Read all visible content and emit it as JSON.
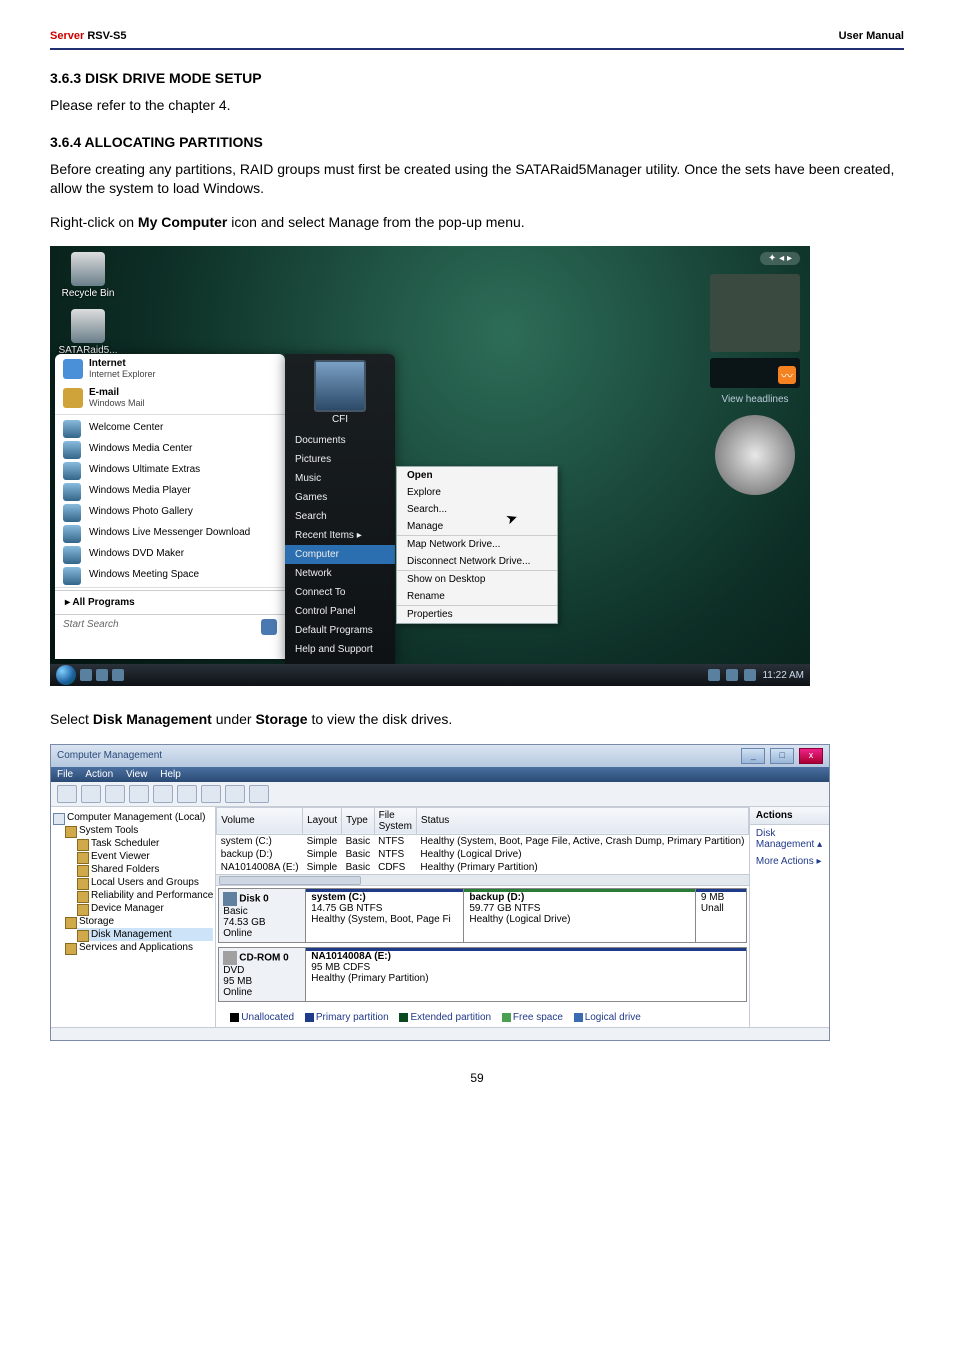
{
  "header": {
    "server_label": "Server",
    "model": " RSV-S5",
    "right": "User Manual"
  },
  "section1": {
    "title": "3.6.3 DISK DRIVE MODE SETUP",
    "text": "Please refer to the chapter 4."
  },
  "section2": {
    "title": "3.6.4 ALLOCATING PARTITIONS",
    "text": "Before creating any partitions, RAID groups must first be created using the SATARaid5Manager utility. Once the sets have been created, allow the system to load Windows.",
    "step1a": "Right-click on ",
    "step1b": "My Computer",
    "step1c": " icon and select Manage from the pop-up menu.",
    "step2a": "Select ",
    "step2b": "Disk Management",
    "step2c": " under ",
    "step2d": "Storage",
    "step2e": " to view the disk drives."
  },
  "shot1": {
    "titlebar_arrows": "✦  ◂ ▸",
    "desk": {
      "recycle": "Recycle Bin",
      "sataraid": "SATARaid5..."
    },
    "sidebar": {
      "headlines": "View headlines"
    },
    "start_left": {
      "internet_t": "Internet",
      "internet_s": "Internet Explorer",
      "email_t": "E-mail",
      "email_s": "Windows Mail",
      "items": [
        "Welcome Center",
        "Windows Media Center",
        "Windows Ultimate Extras",
        "Windows Media Player",
        "Windows Photo Gallery",
        "Windows Live Messenger Download",
        "Windows DVD Maker",
        "Windows Meeting Space"
      ],
      "all": "▸    All Programs",
      "search": "Start Search"
    },
    "start_right": {
      "name": "CFI",
      "items": [
        "Documents",
        "Pictures",
        "Music",
        "Games",
        "Search",
        "Recent Items        ▸",
        "Computer",
        "Network",
        "Connect To",
        "Control Panel",
        "Default Programs",
        "Help and Support"
      ],
      "selected_index": 6
    },
    "ctx": [
      "Open",
      "Explore",
      "Search...",
      "Manage",
      "Map Network Drive...",
      "Disconnect Network Drive...",
      "Show on Desktop",
      "Rename",
      "Properties"
    ],
    "taskbar": {
      "time": "11:22 AM"
    }
  },
  "shot2": {
    "title": "Computer Management",
    "menu": [
      "File",
      "Action",
      "View",
      "Help"
    ],
    "tree": {
      "root": "Computer Management (Local)",
      "system_tools": "System Tools",
      "st_items": [
        "Task Scheduler",
        "Event Viewer",
        "Shared Folders",
        "Local Users and Groups",
        "Reliability and Performance",
        "Device Manager"
      ],
      "storage": "Storage",
      "storage_items": [
        "Disk Management"
      ],
      "services": "Services and Applications"
    },
    "grid": {
      "headers": [
        "Volume",
        "Layout",
        "Type",
        "File System",
        "Status"
      ],
      "rows": [
        {
          "v": "system (C:)",
          "l": "Simple",
          "t": "Basic",
          "f": "NTFS",
          "s": "Healthy (System, Boot, Page File, Active, Crash Dump, Primary Partition)"
        },
        {
          "v": "backup (D:)",
          "l": "Simple",
          "t": "Basic",
          "f": "NTFS",
          "s": "Healthy (Logical Drive)"
        },
        {
          "v": "NA1014008A (E:)",
          "l": "Simple",
          "t": "Basic",
          "f": "CDFS",
          "s": "Healthy (Primary Partition)"
        }
      ]
    },
    "disk0": {
      "head_t": "Disk 0",
      "head_type": "Basic",
      "head_size": "74.53 GB",
      "head_status": "Online",
      "p1_t": "system (C:)",
      "p1_s": "14.75 GB NTFS",
      "p1_st": "Healthy (System, Boot, Page Fi",
      "p2_t": "backup (D:)",
      "p2_s": "59.77 GB NTFS",
      "p2_st": "Healthy (Logical Drive)",
      "p3_t": "",
      "p3_s": "9 MB",
      "p3_st": "Unall"
    },
    "cd0": {
      "head_t": "CD-ROM 0",
      "head_type": "DVD",
      "head_size": "95 MB",
      "head_status": "Online",
      "p1_t": "NA1014008A (E:)",
      "p1_s": "95 MB CDFS",
      "p1_st": "Healthy (Primary Partition)"
    },
    "legend": {
      "unalloc": "Unallocated",
      "primary": "Primary partition",
      "ext": "Extended partition",
      "free": "Free space",
      "logical": "Logical drive"
    },
    "actions": {
      "header": "Actions",
      "a1": "Disk Management  ▴",
      "a2": "More Actions   ▸"
    }
  },
  "pagenum": "59"
}
